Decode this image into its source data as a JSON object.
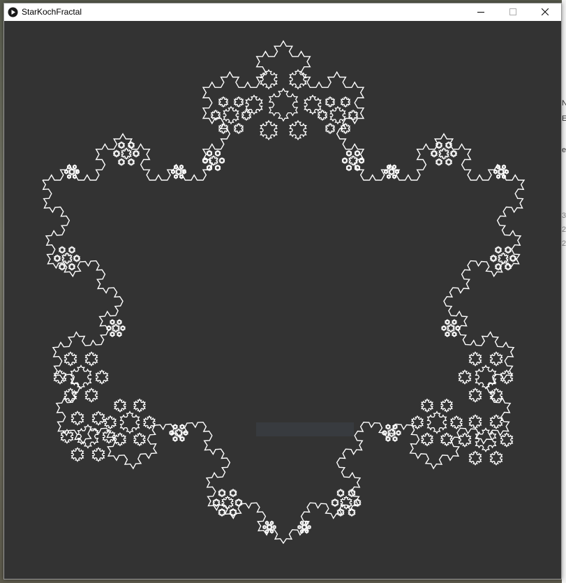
{
  "window": {
    "title": "StarKochFractal",
    "minimize_glyph": "—",
    "maximize_glyph": "☐",
    "close_glyph": "✕"
  },
  "icons": {
    "app": "play-icon",
    "minimize": "minimize-icon",
    "maximize": "maximize-icon",
    "close": "close-icon"
  },
  "canvas": {
    "background_color": "#333333",
    "stroke_color": "#ffffff",
    "fractal": "star-koch"
  },
  "colors": {
    "titlebar": "#ffffff",
    "close_hover": "#e81123"
  }
}
